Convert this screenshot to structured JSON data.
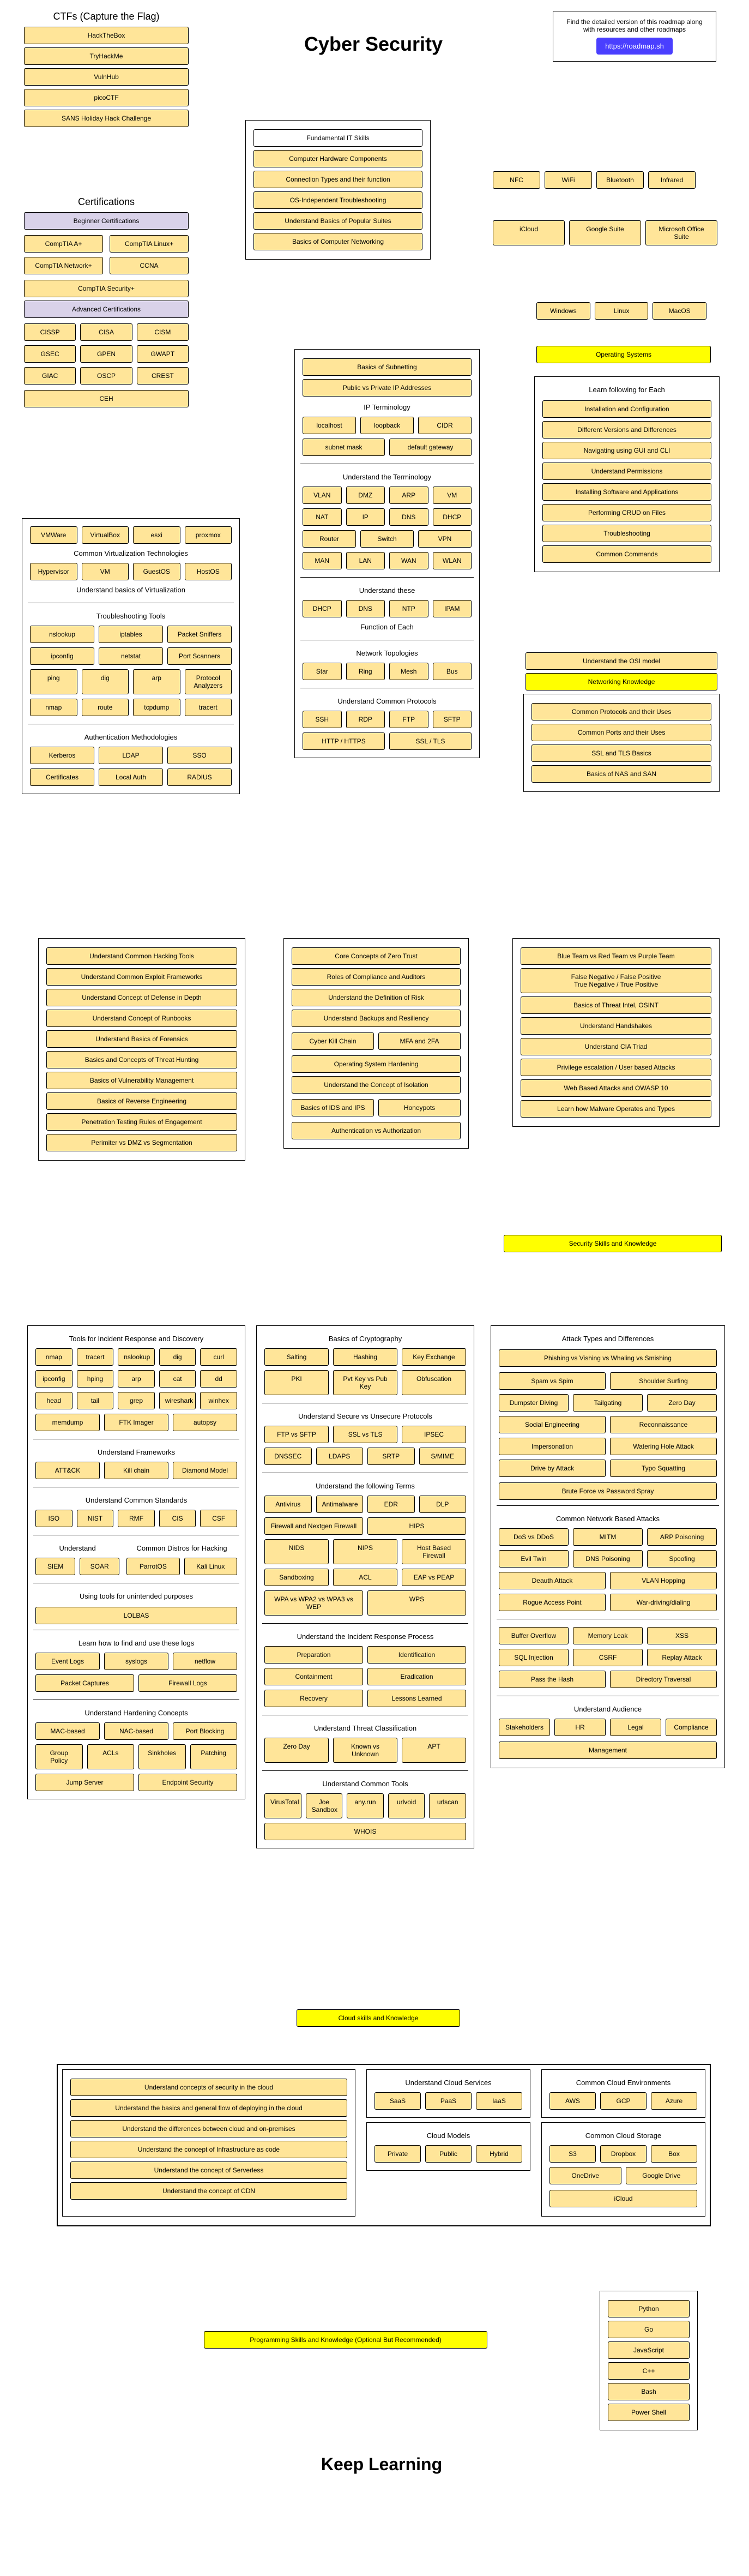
{
  "title": "Cyber Security",
  "keep_learning": "Keep Learning",
  "cta": {
    "text": "Find the detailed version of this roadmap along with resources and other roadmaps",
    "button": "https://roadmap.sh"
  },
  "ctf": {
    "title": "CTFs (Capture the Flag)",
    "items": [
      "HackTheBox",
      "TryHackMe",
      "VulnHub",
      "picoCTF",
      "SANS Holiday Hack Challenge"
    ]
  },
  "certs": {
    "title": "Certifications",
    "beginner": {
      "label": "Beginner Certifications",
      "items": [
        "CompTIA A+",
        "CompTIA Linux+",
        "CompTIA Network+",
        "CCNA"
      ],
      "single": "CompTIA Security+"
    },
    "advanced": {
      "label": "Advanced Certifications",
      "items": [
        "CISSP",
        "CISA",
        "CISM",
        "GSEC",
        "GPEN",
        "GWAPT",
        "GIAC",
        "OSCP",
        "CREST"
      ],
      "single": "CEH"
    }
  },
  "fund": {
    "title": "Fundamental IT Skills",
    "items": [
      "Computer Hardware Components",
      "Connection Types and their function",
      "OS-Independent Troubleshooting",
      "Understand Basics of Popular Suites",
      "Basics of Computer Networking"
    ],
    "conn": [
      "NFC",
      "WiFi",
      "Bluetooth",
      "Infrared"
    ],
    "suites": [
      "iCloud",
      "Google Suite",
      "Microsoft Office Suite"
    ]
  },
  "os": {
    "title": "Operating Systems",
    "types": [
      "Windows",
      "Linux",
      "MacOS"
    ],
    "learn": {
      "title": "Learn following for Each",
      "items": [
        "Installation and Configuration",
        "Different Versions and Differences",
        "Navigating using GUI and CLI",
        "Understand Permissions",
        "Installing Software and Applications",
        "Performing CRUD on Files",
        "Troubleshooting",
        "Common Commands"
      ]
    }
  },
  "subnet": {
    "basics": "Basics of Subnetting",
    "pub": "Public vs Private IP Addresses",
    "ip_term": "IP Terminology",
    "ipitems": [
      "localhost",
      "loopback",
      "CIDR",
      "subnet mask",
      "default gateway"
    ],
    "term": "Understand the Terminology",
    "termitems": [
      "VLAN",
      "DMZ",
      "ARP",
      "VM",
      "NAT",
      "IP",
      "DNS",
      "DHCP",
      "Router",
      "Switch",
      "VPN",
      "MAN",
      "LAN",
      "WAN",
      "WLAN"
    ],
    "these": "Understand these",
    "theseitems": [
      "DHCP",
      "DNS",
      "NTP",
      "IPAM"
    ],
    "func": "Function of Each",
    "topo": "Network Topologies",
    "topoitems": [
      "Star",
      "Ring",
      "Mesh",
      "Bus"
    ],
    "proto": "Understand Common Protocols",
    "protoitems": [
      "SSH",
      "RDP",
      "FTP",
      "SFTP",
      "HTTP / HTTPS",
      "SSL / TLS"
    ]
  },
  "virt": {
    "tools": [
      "VMWare",
      "VirtualBox",
      "esxi",
      "proxmox"
    ],
    "tech": "Common Virtualization Technologies",
    "techitems": [
      "Hypervisor",
      "VM",
      "GuestOS",
      "HostOS"
    ],
    "basics": "Understand basics of Virtualization",
    "trouble": "Troubleshooting Tools",
    "troubleitems": [
      "nslookup",
      "iptables",
      "Packet Sniffers",
      "ipconfig",
      "netstat",
      "Port Scanners",
      "ping",
      "dig",
      "arp",
      "Protocol Analyzers",
      "nmap",
      "route",
      "tcpdump",
      "tracert"
    ],
    "auth": "Authentication Methodologies",
    "authitems": [
      "Kerberos",
      "LDAP",
      "SSO",
      "Certificates",
      "Local Auth",
      "RADIUS"
    ]
  },
  "net": {
    "title": "Networking Knowledge",
    "osi": "Understand the OSI model",
    "items": [
      "Common Protocols and their Uses",
      "Common Ports and their Uses",
      "SSL and TLS Basics",
      "Basics of NAS and SAN"
    ]
  },
  "hacking": [
    "Understand Common Hacking Tools",
    "Understand Common Exploit Frameworks",
    "Understand Concept of Defense in Depth",
    "Understand Concept of Runbooks",
    "Understand Basics of Forensics",
    "Basics and Concepts of Threat Hunting",
    "Basics of Vulnerability Management",
    "Basics of Reverse Engineering",
    "Penetration Testing Rules of Engagement",
    "Perimiter vs DMZ vs Segmentation"
  ],
  "zerotrust": [
    "Core Concepts of Zero Trust",
    "Roles of Compliance and Auditors",
    "Understand the Definition of Risk",
    "Understand Backups and Resiliency"
  ],
  "zt2": [
    "Cyber Kill Chain",
    "MFA and 2FA"
  ],
  "zt3": [
    "Operating System Hardening",
    "Understand the Concept of Isolation"
  ],
  "zt4": [
    "Basics of IDS and IPS",
    "Honeypots"
  ],
  "zt5": "Authentication vs Authorization",
  "teams": [
    "Blue Team vs Red Team vs Purple Team",
    "False Negative / False Positive\nTrue Negative / True Positive",
    "Basics of Threat Intel, OSINT",
    "Understand Handshakes",
    "Understand CIA Triad",
    "Privilege escalation / User based Attacks",
    "Web Based Attacks and OWASP 10",
    "Learn how Malware Operates and Types"
  ],
  "security_yellow": "Security Skills and Knowledge",
  "incident": {
    "title": "Tools for Incident Response and Discovery",
    "tools": [
      "nmap",
      "tracert",
      "nslookup",
      "dig",
      "curl",
      "ipconfig",
      "hping",
      "arp",
      "cat",
      "dd",
      "head",
      "tail",
      "grep",
      "wireshark",
      "winhex",
      "memdump",
      "FTK Imager",
      "autopsy"
    ],
    "frame": "Understand Frameworks",
    "frameitems": [
      "ATT&CK",
      "Kill chain",
      "Diamond Model"
    ],
    "std": "Understand Common Standards",
    "stditems": [
      "ISO",
      "NIST",
      "RMF",
      "CIS",
      "CSF"
    ],
    "und": "Understand",
    "unditems": [
      "SIEM",
      "SOAR"
    ],
    "distro": "Common Distros for Hacking",
    "distroitems": [
      "ParrotOS",
      "Kali Linux"
    ],
    "unint": "Using tools for unintended purposes",
    "lolbas": "LOLBAS",
    "logs": "Learn how to find and use these logs",
    "logitems": [
      "Event Logs",
      "syslogs",
      "netflow",
      "Packet Captures",
      "Firewall Logs"
    ],
    "hard": "Understand Hardening Concepts",
    "harditems": [
      "MAC-based",
      "NAC-based",
      "Port Blocking",
      "Group Policy",
      "ACLs",
      "Sinkholes",
      "Patching",
      "Jump Server",
      "Endpoint Security"
    ]
  },
  "crypto": {
    "basics": "Basics of Cryptography",
    "bitems": [
      "Salting",
      "Hashing",
      "Key Exchange",
      "PKI",
      "Pvt Key vs Pub Key",
      "Obfuscation"
    ],
    "secure": "Understand Secure vs Unsecure Protocols",
    "sitems": [
      "FTP vs SFTP",
      "SSL vs TLS",
      "IPSEC",
      "DNSSEC",
      "LDAPS",
      "SRTP",
      "S/MIME"
    ],
    "terms": "Understand the following Terms",
    "titems": [
      "Antivirus",
      "Antimalware",
      "EDR",
      "DLP",
      "Firewall and Nextgen Firewall",
      "HIPS",
      "NIDS",
      "NIPS",
      "Host Based Firewall",
      "Sandboxing",
      "ACL",
      "EAP vs PEAP",
      "WPA vs WPA2 vs WPA3 vs WEP",
      "WPS"
    ],
    "irp": "Understand the Incident Response Process",
    "irpitems": [
      "Preparation",
      "Identification",
      "Containment",
      "Eradication",
      "Recovery",
      "Lessons Learned"
    ],
    "threat": "Understand Threat Classification",
    "threatitems": [
      "Zero Day",
      "Known vs Unknown",
      "APT"
    ],
    "common": "Understand Common Tools",
    "commonitems": [
      "VirusTotal",
      "Joe Sandbox",
      "any.run",
      "urlvoid",
      "urlscan",
      "WHOIS"
    ]
  },
  "attacks": {
    "title": "Attack Types and Differences",
    "a": [
      "Phishing vs Vishing vs Whaling vs Smishing",
      "Spam vs Spim",
      "Shoulder Surfing"
    ],
    "b": [
      "Dumpster Diving",
      "Tailgating",
      "Zero Day",
      "Social Engineering",
      "Reconnaissance",
      "Impersonation",
      "Watering Hole Attack",
      "Drive by Attack",
      "Typo Squatting",
      "Brute Force vs Password Spray"
    ],
    "net": "Common Network Based Attacks",
    "netitems": [
      "DoS vs DDoS",
      "MITM",
      "ARP Poisoning",
      "Evil Twin",
      "DNS Poisoning",
      "Spoofing",
      "Deauth Attack",
      "VLAN Hopping",
      "Rogue Access Point",
      "War-driving/dialing"
    ],
    "other": [
      "Buffer Overflow",
      "Memory Leak",
      "XSS",
      "SQL Injection",
      "CSRF",
      "Replay Attack",
      "Pass the Hash",
      "Directory Traversal"
    ],
    "aud": "Understand Audience",
    "auditems": [
      "Stakeholders",
      "HR",
      "Legal",
      "Compliance",
      "Management"
    ]
  },
  "cloud": {
    "yellow": "Cloud skills and Knowledge",
    "concepts": [
      "Understand concepts of security in the cloud",
      "Understand the basics and general flow of deploying in the cloud",
      "Understand the differences between cloud and on-premises",
      "Understand the concept of Infrastructure as code",
      "Understand the concept of Serverless",
      "Understand the concept of CDN"
    ],
    "services": "Understand Cloud Services",
    "sitems": [
      "SaaS",
      "PaaS",
      "IaaS"
    ],
    "models": "Cloud Models",
    "mitems": [
      "Private",
      "Public",
      "Hybrid"
    ],
    "env": "Common Cloud Environments",
    "eitems": [
      "AWS",
      "GCP",
      "Azure"
    ],
    "storage": "Common Cloud Storage",
    "stitems": [
      "S3",
      "Dropbox",
      "Box",
      "OneDrive",
      "Google Drive",
      "iCloud"
    ]
  },
  "prog": {
    "yellow": "Programming Skills and Knowledge (Optional But Recommended)",
    "langs": [
      "Python",
      "Go",
      "JavaScript",
      "C++",
      "Bash",
      "Power Shell"
    ]
  }
}
